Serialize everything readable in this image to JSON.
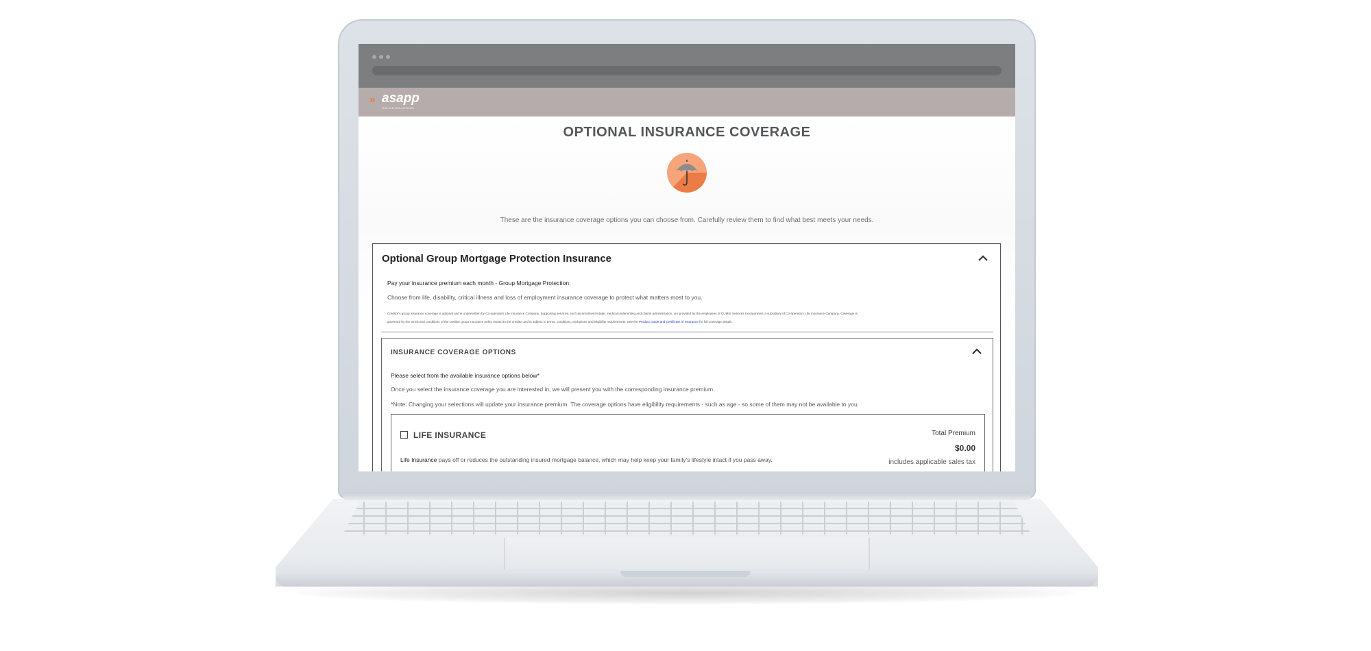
{
  "app": {
    "logo_text": "asapp",
    "logo_subtext": "ONLINE SOLUTIONS"
  },
  "page": {
    "title": "OPTIONAL INSURANCE COVERAGE",
    "intro": "These are the insurance coverage options you can choose from. Carefully review them to find what best meets your needs."
  },
  "group_section": {
    "title": "Optional Group Mortgage Protection Insurance",
    "subtitle": "Pay your insurance premium each month - Group Mortgage Protection",
    "description": "Choose from life, disability, critical illness and loss of employment insurance coverage to protect what matters most to you.",
    "fine_print_1": "Creditor's group insurance coverage is optional and is underwritten by Co-operators Life Insurance Company. Supporting services, such as enrolment intake, medical underwriting and claims administration, are provided by the employees of CUMIS Services Incorporated, a subsidiary of Co-operators Life Insurance Company. Coverage is",
    "fine_print_2": "governed by the terms and conditions of the creditor group insurance policy issued to the creditor and is subject to terms, conditions, exclusions and eligibility requirements. See the",
    "fine_print_link": "Product Guide and Certificate of Insurance",
    "fine_print_3": "for full coverage details."
  },
  "coverage_options": {
    "title": "INSURANCE COVERAGE OPTIONS",
    "instruction": "Please select from the available insurance options below*",
    "info": "Once you select the insurance coverage you are interested in, we will present you with the corresponding insurance premium.",
    "note": "*Note: Changing your selections will update your insurance premium. The coverage options have eligibility requirements - such as age - so some of them may not be available to you."
  },
  "life_insurance": {
    "title": "LIFE INSURANCE",
    "desc_bold": "Life Insurance",
    "desc_rest": " pays off or reduces the outstanding insured mortgage balance, which may help keep your family's lifestyle intact if you pass away.",
    "premium_label": "Total Premium",
    "premium_value": "$0.00",
    "premium_note": "includes applicable sales tax"
  },
  "colors": {
    "accent_orange": "#f07a3a",
    "header_bg": "#b5acab",
    "browser_chrome": "#7d7e80",
    "link": "#1a2fd0"
  },
  "icons": {
    "umbrella": "umbrella-icon",
    "collapse": "chevron-up-icon",
    "checkbox": "checkbox-icon"
  }
}
